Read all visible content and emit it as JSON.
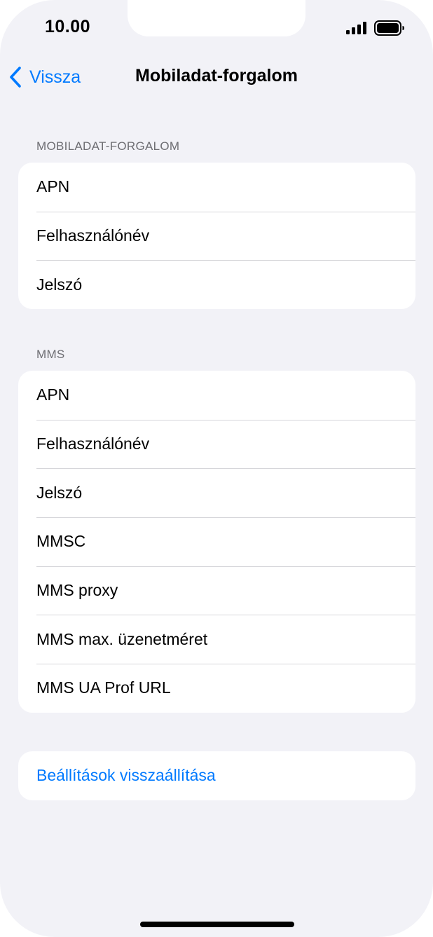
{
  "status_bar": {
    "time": "10.00",
    "signal_icon": "cellular-signal-icon",
    "battery_icon": "battery-icon"
  },
  "nav": {
    "back_label": "Vissza",
    "back_icon": "chevron-left-icon",
    "title": "Mobiladat-forgalom"
  },
  "sections": {
    "cellular": {
      "header": "MOBILADAT-FORGALOM",
      "items": [
        "APN",
        "Felhasználónév",
        "Jelszó"
      ]
    },
    "mms": {
      "header": "MMS",
      "items": [
        "APN",
        "Felhasználónév",
        "Jelszó",
        "MMSC",
        "MMS proxy",
        "MMS max. üzenetméret",
        "MMS UA Prof URL"
      ]
    },
    "reset": {
      "label": "Beállítások visszaállítása"
    }
  },
  "colors": {
    "accent": "#007aff",
    "background": "#f2f2f7",
    "section_header": "#6d6d72"
  }
}
